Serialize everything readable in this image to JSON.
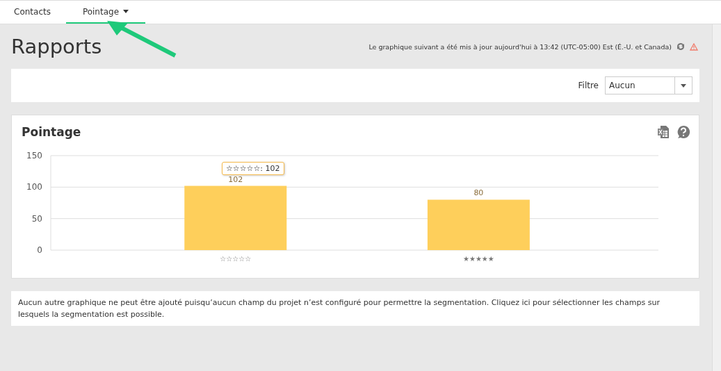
{
  "tabs": [
    {
      "label": "Contacts",
      "selected": false,
      "dropdown": false
    },
    {
      "label": "Pointage",
      "selected": true,
      "dropdown": true
    }
  ],
  "page_title": "Rapports",
  "update_notice": "Le graphique suivant a été mis à jour aujourd'hui à 13:42 (UTC-05:00) Est (É.-U. et Canada)",
  "filter": {
    "label": "Filtre",
    "value": "Aucun"
  },
  "chart_panel": {
    "title": "Pointage",
    "tooltip": "☆☆☆☆☆: 102",
    "chart_data": {
      "type": "bar",
      "categories": [
        "☆☆☆☆☆",
        "★★★★★"
      ],
      "series": [
        {
          "color": "#fecf5b",
          "values": [
            102,
            80
          ]
        }
      ],
      "ylim": [
        0,
        150
      ],
      "yticks": [
        0,
        50,
        100,
        150
      ],
      "data_labels": true
    }
  },
  "footer_message": "Aucun autre graphique ne peut être ajouté puisqu’aucun champ du projet n’est configuré pour permettre la segmentation. Cliquez ici pour sélectionner les champs sur lesquels la segmentation est possible."
}
